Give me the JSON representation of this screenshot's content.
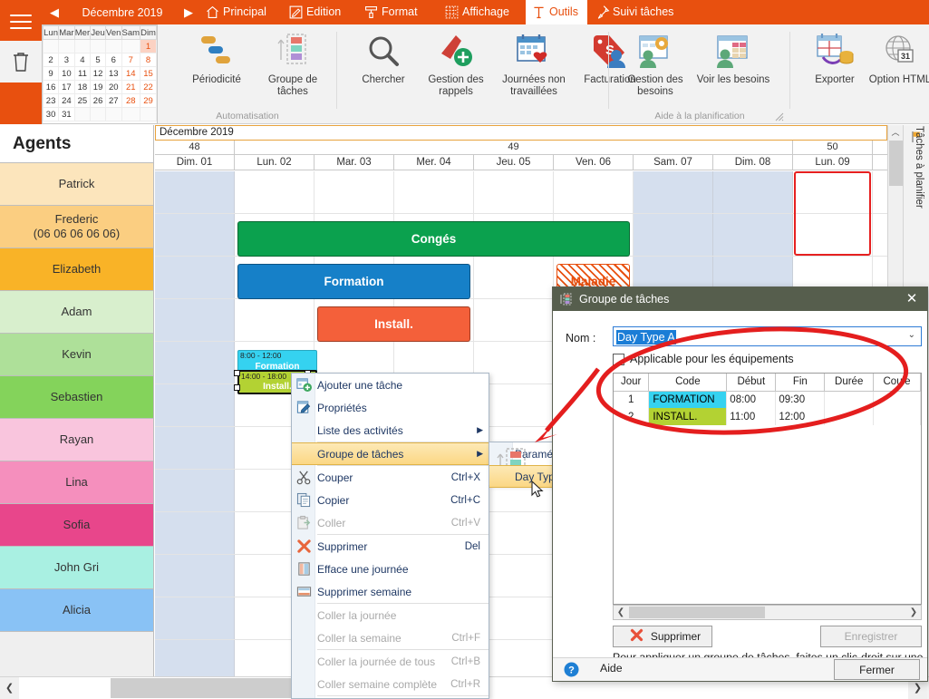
{
  "ribbon": {
    "month_label": "Décembre 2019",
    "prev_icon": "chevron-left-icon",
    "next_icon": "chevron-right-icon",
    "tabs": [
      {
        "label": "Principal",
        "icon": "home-icon",
        "active": false
      },
      {
        "label": "Edition",
        "icon": "edit-icon",
        "active": false
      },
      {
        "label": "Format",
        "icon": "format-paint-icon",
        "active": false
      },
      {
        "label": "Affichage",
        "icon": "grid-icon",
        "active": false
      },
      {
        "label": "Outils",
        "icon": "tools-icon",
        "active": true
      },
      {
        "label": "Suivi tâches",
        "icon": "pin-icon",
        "active": false
      }
    ],
    "groups": [
      {
        "label": "Automatisation",
        "buttons": [
          {
            "label": "Périodicité",
            "icon": "recurrence-icon"
          },
          {
            "label": "Groupe de tâches",
            "icon": "task-group-icon"
          }
        ]
      },
      {
        "label": "",
        "buttons": [
          {
            "label": "Chercher",
            "icon": "magnifier-icon"
          },
          {
            "label": "Gestion des rappels",
            "icon": "reminder-add-icon"
          },
          {
            "label": "Journées non travaillées",
            "icon": "calendar-heart-icon"
          },
          {
            "label": "Facturation",
            "icon": "billing-tag-icon"
          }
        ]
      },
      {
        "label": "Aide à la planification",
        "buttons": [
          {
            "label": "Gestion des besoins",
            "icon": "needs-manage-icon"
          },
          {
            "label": "Voir les besoins",
            "icon": "needs-view-icon"
          }
        ]
      },
      {
        "label": "",
        "buttons": [
          {
            "label": "Exporter",
            "icon": "export-db-icon"
          },
          {
            "label": "Option HTML",
            "icon": "html-globe-icon"
          }
        ]
      }
    ]
  },
  "mini_calendar": {
    "weekday_headers": [
      "Lun",
      "Mar",
      "Mer",
      "Jeu",
      "Ven",
      "Sam",
      "Dim"
    ],
    "weeks": [
      [
        {
          "d": "",
          "t": "empty"
        },
        {
          "d": "",
          "t": "empty"
        },
        {
          "d": "",
          "t": "empty"
        },
        {
          "d": "",
          "t": "empty"
        },
        {
          "d": "",
          "t": "empty"
        },
        {
          "d": "",
          "t": "empty"
        },
        {
          "d": "1",
          "t": "sel"
        }
      ],
      [
        {
          "d": "2",
          "t": ""
        },
        {
          "d": "3",
          "t": ""
        },
        {
          "d": "4",
          "t": ""
        },
        {
          "d": "5",
          "t": ""
        },
        {
          "d": "6",
          "t": ""
        },
        {
          "d": "7",
          "t": "we"
        },
        {
          "d": "8",
          "t": "we"
        }
      ],
      [
        {
          "d": "9",
          "t": ""
        },
        {
          "d": "10",
          "t": ""
        },
        {
          "d": "11",
          "t": ""
        },
        {
          "d": "12",
          "t": ""
        },
        {
          "d": "13",
          "t": ""
        },
        {
          "d": "14",
          "t": "we"
        },
        {
          "d": "15",
          "t": "we"
        }
      ],
      [
        {
          "d": "16",
          "t": ""
        },
        {
          "d": "17",
          "t": ""
        },
        {
          "d": "18",
          "t": ""
        },
        {
          "d": "19",
          "t": ""
        },
        {
          "d": "20",
          "t": ""
        },
        {
          "d": "21",
          "t": "we"
        },
        {
          "d": "22",
          "t": "we"
        }
      ],
      [
        {
          "d": "23",
          "t": ""
        },
        {
          "d": "24",
          "t": ""
        },
        {
          "d": "25",
          "t": ""
        },
        {
          "d": "26",
          "t": ""
        },
        {
          "d": "27",
          "t": ""
        },
        {
          "d": "28",
          "t": "we"
        },
        {
          "d": "29",
          "t": "we"
        }
      ],
      [
        {
          "d": "30",
          "t": ""
        },
        {
          "d": "31",
          "t": ""
        },
        {
          "d": "",
          "t": "empty"
        },
        {
          "d": "",
          "t": "empty"
        },
        {
          "d": "",
          "t": "empty"
        },
        {
          "d": "",
          "t": "empty"
        },
        {
          "d": "",
          "t": "empty"
        }
      ]
    ]
  },
  "agents_panel": {
    "header": "Agents",
    "agents": [
      {
        "name": "Patrick",
        "color": "#FCE5BC"
      },
      {
        "name": "Frederic\n(06 06 06 06 06)",
        "color": "#FBCE81"
      },
      {
        "name": "Elizabeth",
        "color": "#F9B327"
      },
      {
        "name": "Adam",
        "color": "#D8EFCD"
      },
      {
        "name": "Kevin",
        "color": "#AEE099"
      },
      {
        "name": "Sebastien",
        "color": "#84D35B"
      },
      {
        "name": "Rayan",
        "color": "#F9C5DD"
      },
      {
        "name": "Lina",
        "color": "#F58FBD"
      },
      {
        "name": "Sofia",
        "color": "#E8468B"
      },
      {
        "name": "John Gri",
        "color": "#A9F0E2"
      },
      {
        "name": "Alicia",
        "color": "#89C2F5"
      }
    ]
  },
  "calendar": {
    "title": "Décembre 2019",
    "weeks": [
      {
        "num": "48",
        "span": 1
      },
      {
        "num": "49",
        "span": 7
      },
      {
        "num": "50",
        "span": 1
      }
    ],
    "days": [
      {
        "label": "Dim. 01",
        "weekend": true
      },
      {
        "label": "Lun. 02",
        "weekend": false
      },
      {
        "label": "Mar. 03",
        "weekend": false
      },
      {
        "label": "Mer. 04",
        "weekend": false
      },
      {
        "label": "Jeu. 05",
        "weekend": false
      },
      {
        "label": "Ven. 06",
        "weekend": false
      },
      {
        "label": "Sam. 07",
        "weekend": true
      },
      {
        "label": "Dim. 08",
        "weekend": true
      },
      {
        "label": "Lun. 09",
        "weekend": false
      }
    ],
    "tasks": [
      {
        "label": "Congés",
        "color": "#0BA14E",
        "col": 1,
        "span": 5,
        "row": 2,
        "time": ""
      },
      {
        "label": "Formation",
        "color": "#1680C8",
        "col": 1,
        "span": 3,
        "row": 3,
        "time": ""
      },
      {
        "label": "Maladie",
        "color": "#E8500F",
        "col": 5,
        "span": 1,
        "row": 3,
        "time": "",
        "hatched": true
      },
      {
        "label": "Install.",
        "color": "#F4603A",
        "col": 2,
        "span": 2,
        "row": 4,
        "time": ""
      },
      {
        "label": "Formation",
        "color": "#35D2F0",
        "col": 1,
        "span": 1,
        "row": 5,
        "time": "8:00 - 12:00",
        "small": true
      },
      {
        "label": "Install.",
        "color": "#B3D233",
        "col": 1,
        "span": 1,
        "row": 5.5,
        "time": "14:00 - 18:00",
        "small": true,
        "selected": true
      }
    ],
    "selected_cell_day": "Lun. 09"
  },
  "right_strip": {
    "label": "Tâches à planifier",
    "flag_icon": "flag-icon"
  },
  "context_menu": {
    "items": [
      {
        "label": "Ajouter une tâche",
        "icon": "add-task-icon",
        "accel": "",
        "arrow": false,
        "disabled": false,
        "highlight": false
      },
      {
        "label": "Propriétés",
        "icon": "properties-icon",
        "accel": "",
        "arrow": false,
        "disabled": false,
        "highlight": false
      },
      {
        "label": "Liste des activités",
        "icon": "",
        "accel": "",
        "arrow": true,
        "disabled": false,
        "highlight": false
      },
      {
        "sep": true
      },
      {
        "label": "Groupe de tâches",
        "icon": "",
        "accel": "",
        "arrow": true,
        "disabled": false,
        "highlight": true
      },
      {
        "sep": true
      },
      {
        "label": "Couper",
        "icon": "scissors-icon",
        "accel": "Ctrl+X",
        "arrow": false,
        "disabled": false,
        "highlight": false
      },
      {
        "label": "Copier",
        "icon": "copy-icon",
        "accel": "Ctrl+C",
        "arrow": false,
        "disabled": false,
        "highlight": false
      },
      {
        "label": "Coller",
        "icon": "paste-icon",
        "accel": "Ctrl+V",
        "arrow": false,
        "disabled": true,
        "highlight": false
      },
      {
        "sep": true
      },
      {
        "label": "Supprimer",
        "icon": "delete-x-icon",
        "accel": "Del",
        "arrow": false,
        "disabled": false,
        "highlight": false
      },
      {
        "label": "Efface une journée",
        "icon": "clear-day-icon",
        "accel": "",
        "arrow": false,
        "disabled": false,
        "highlight": false
      },
      {
        "label": "Supprimer semaine",
        "icon": "delete-week-icon",
        "accel": "",
        "arrow": false,
        "disabled": false,
        "highlight": false
      },
      {
        "sep": true
      },
      {
        "label": "Coller la journée",
        "icon": "",
        "accel": "",
        "arrow": false,
        "disabled": true,
        "highlight": false
      },
      {
        "label": "Coller la semaine",
        "icon": "",
        "accel": "Ctrl+F",
        "arrow": false,
        "disabled": true,
        "highlight": false
      },
      {
        "sep": true
      },
      {
        "label": "Coller la journée de tous",
        "icon": "",
        "accel": "Ctrl+B",
        "arrow": false,
        "disabled": true,
        "highlight": false
      },
      {
        "label": "Coller semaine complète",
        "icon": "",
        "accel": "Ctrl+R",
        "arrow": false,
        "disabled": true,
        "highlight": false
      },
      {
        "sep": true
      }
    ]
  },
  "sub_menu": {
    "items": [
      {
        "label": "Paramétrer",
        "icon": "task-group-icon",
        "highlight": false
      },
      {
        "label": "Day Type A",
        "icon": "",
        "highlight": true
      }
    ]
  },
  "dialog": {
    "title": "Groupe de tâches",
    "title_icon": "task-group-icon",
    "close_icon": "close-icon",
    "nom_label": "Nom :",
    "nom_value": "Day Type A",
    "checkbox_label": "Applicable pour les équipements",
    "checkbox_checked": false,
    "table": {
      "columns": [
        "Jour",
        "Code",
        "Début",
        "Fin",
        "Durée",
        "Coule"
      ],
      "rows": [
        {
          "jour": "1",
          "code": "FORMATION",
          "debut": "08:00",
          "fin": "09:30",
          "duree": "",
          "couleur": "",
          "code_color": "#35D2F0"
        },
        {
          "jour": "2",
          "code": "INSTALL.",
          "debut": "11:00",
          "fin": "12:00",
          "duree": "",
          "couleur": "",
          "code_color": "#B3D233"
        }
      ]
    },
    "delete_button": "Supprimer",
    "save_button": "Enregistrer",
    "save_enabled": false,
    "hint": "Pour appliquer un groupe de tâches, faites un clic-droit sur une journée puis choisissez le groupe de tâches.",
    "help_label": "Aide",
    "help_icon": "help-circle-icon",
    "close_button": "Fermer"
  },
  "annotation": {
    "color": "#E41E1E",
    "shape": "ellipse-with-arrow"
  }
}
